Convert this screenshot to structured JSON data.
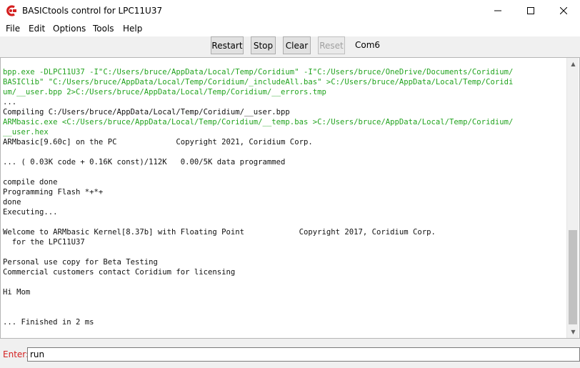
{
  "window": {
    "title": "BASICtools control for LPC11U37",
    "app_icon": "coridium-logo-icon",
    "controls": {
      "minimize": "minimize-icon",
      "maximize": "maximize-icon",
      "close": "close-icon"
    }
  },
  "menu": [
    "File",
    "Edit",
    "Options",
    "Tools",
    "Help"
  ],
  "toolbar": {
    "buttons": [
      "Restart",
      "Stop",
      "Clear",
      "Reset"
    ],
    "disabled": [
      "Reset"
    ],
    "port": "Com6"
  },
  "colors": {
    "command_text": "#22a31f",
    "normal_text": "#111111",
    "enter_label": "#d42020"
  },
  "console": {
    "lines": [
      {
        "text": "bpp.exe -DLPC11U37 -I\"C:/Users/bruce/AppData/Local/Temp/Coridium\" -I\"C:/Users/bruce/OneDrive/Documents/Coridium/",
        "color": "green"
      },
      {
        "text": "BASIClib\" \"C:/Users/bruce/AppData/Local/Temp/Coridium/_includeAll.bas\" >C:/Users/bruce/AppData/Local/Temp/Coridi",
        "color": "green"
      },
      {
        "text": "um/__user.bpp 2>C:/Users/bruce/AppData/Local/Temp/Coridium/__errors.tmp",
        "color": "green"
      },
      {
        "text": "...",
        "color": "black"
      },
      {
        "text": "Compiling C:/Users/bruce/AppData/Local/Temp/Coridium/__user.bpp",
        "color": "black"
      },
      {
        "text": "ARMbasic.exe <C:/Users/bruce/AppData/Local/Temp/Coridium/__temp.bas >C:/Users/bruce/AppData/Local/Temp/Coridium/",
        "color": "green"
      },
      {
        "text": "__user.hex",
        "color": "green"
      },
      {
        "text": "ARMbasic[9.60c] on the PC             Copyright 2021, Coridium Corp.",
        "color": "black"
      },
      {
        "text": "",
        "color": "black"
      },
      {
        "text": "... ( 0.03K code + 0.16K const)/112K   0.00/5K data programmed",
        "color": "black"
      },
      {
        "text": "",
        "color": "black"
      },
      {
        "text": "compile done",
        "color": "black"
      },
      {
        "text": "Programming Flash *+*+",
        "color": "black"
      },
      {
        "text": "done",
        "color": "black"
      },
      {
        "text": "Executing...",
        "color": "black"
      },
      {
        "text": "",
        "color": "black"
      },
      {
        "text": "Welcome to ARMbasic Kernel[8.37b] with Floating Point            Copyright 2017, Coridium Corp.",
        "color": "black"
      },
      {
        "text": "  for the LPC11U37",
        "color": "black"
      },
      {
        "text": "",
        "color": "black"
      },
      {
        "text": "Personal use copy for Beta Testing",
        "color": "black"
      },
      {
        "text": "Commercial customers contact Coridium for licensing",
        "color": "black"
      },
      {
        "text": "",
        "color": "black"
      },
      {
        "text": "Hi Mom",
        "color": "black"
      },
      {
        "text": "",
        "color": "black"
      },
      {
        "text": "",
        "color": "black"
      },
      {
        "text": "... Finished in 2 ms",
        "color": "black"
      }
    ]
  },
  "scrollbar": {
    "up": "scroll-up-arrow-icon",
    "down": "scroll-down-arrow-icon"
  },
  "enter": {
    "label": "Enter:",
    "value": "run"
  }
}
